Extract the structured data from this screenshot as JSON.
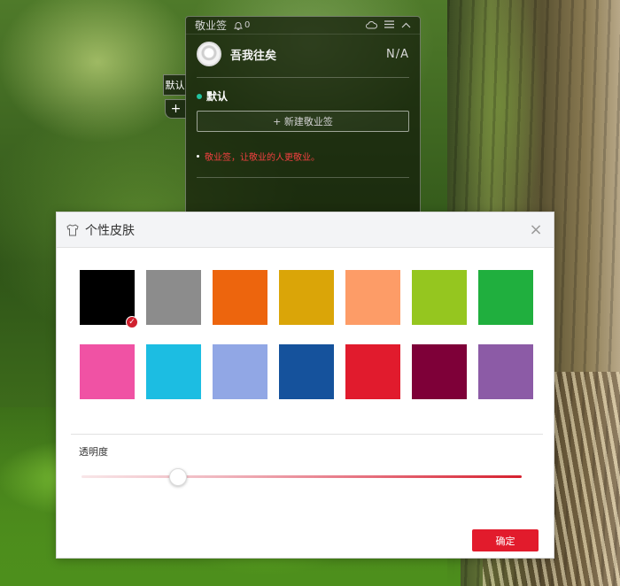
{
  "note_widget": {
    "title": "敬业签",
    "notification_count": "0",
    "user": {
      "name": "吾我往矣",
      "status": "N/A"
    },
    "category": "默认",
    "new_note_label": "+ 新建敬业签",
    "tip": "敬业签，让敬业的人更敬业。",
    "side_tab_label": "默认",
    "side_add_label": "+"
  },
  "skin_dialog": {
    "title": "个性皮肤",
    "close_label": "×",
    "swatches": [
      {
        "color": "#000000",
        "selected": true
      },
      {
        "color": "#8c8c8c",
        "selected": false
      },
      {
        "color": "#ed650d",
        "selected": false
      },
      {
        "color": "#daa508",
        "selected": false
      },
      {
        "color": "#fd9c67",
        "selected": false
      },
      {
        "color": "#95c61f",
        "selected": false
      },
      {
        "color": "#20af3e",
        "selected": false
      },
      {
        "color": "#f052a4",
        "selected": false
      },
      {
        "color": "#1cbde2",
        "selected": false
      },
      {
        "color": "#91a7e5",
        "selected": false
      },
      {
        "color": "#15529c",
        "selected": false
      },
      {
        "color": "#e11b2d",
        "selected": false
      },
      {
        "color": "#7e0038",
        "selected": false
      },
      {
        "color": "#8c5ba6",
        "selected": false
      }
    ],
    "opacity_label": "透明度",
    "opacity_value": 0.22,
    "confirm_label": "确定"
  }
}
